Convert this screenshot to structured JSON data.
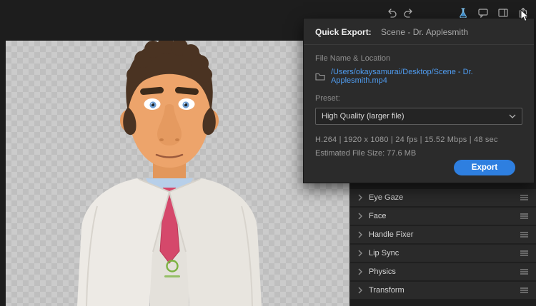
{
  "toolbar": {
    "icons": [
      "undo-icon",
      "redo-icon",
      "flask-icon",
      "comment-icon",
      "panel-layout-icon",
      "share-icon"
    ]
  },
  "quick_export": {
    "title_label": "Quick Export:",
    "scene_name": "Scene - Dr. Applesmith",
    "file_location_label": "File Name & Location",
    "file_path": "/Users/okaysamurai/Desktop/Scene - Dr. Applesmith.mp4",
    "preset_label": "Preset:",
    "preset_value": "High Quality (larger file)",
    "format_info": "H.264 | 1920 x 1080 | 24 fps | 15.52 Mbps | 48 sec",
    "estimated_file_size": "Estimated File Size: 77.6 MB",
    "export_button_label": "Export",
    "accent_color": "#2e7fe0",
    "link_color": "#4f9cf0"
  },
  "behaviors_panel": {
    "rows": [
      {
        "label": "Eye Gaze"
      },
      {
        "label": "Face"
      },
      {
        "label": "Handle Fixer"
      },
      {
        "label": "Lip Sync"
      },
      {
        "label": "Physics"
      },
      {
        "label": "Transform"
      }
    ]
  }
}
